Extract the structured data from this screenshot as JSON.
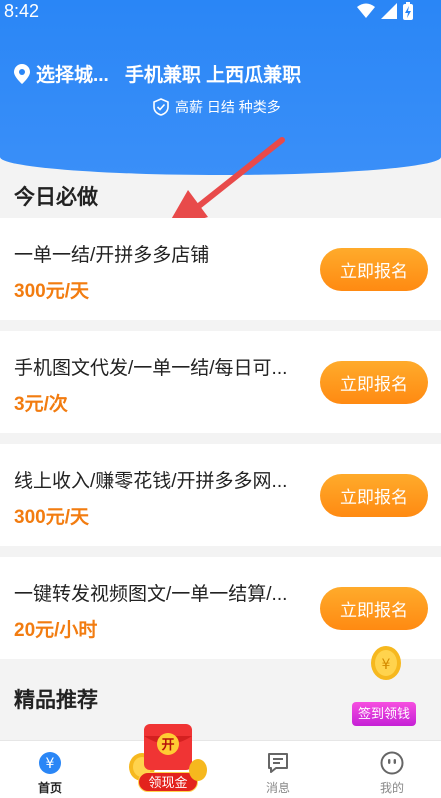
{
  "status": {
    "time": "8:42"
  },
  "header": {
    "city": "选择城...",
    "title": "手机兼职 上西瓜兼职",
    "tagline": "高薪 日结 种类多"
  },
  "sections": {
    "today": "今日必做",
    "featured": "精品推荐"
  },
  "jobs": [
    {
      "name": "一单一结/开拼多多店铺",
      "price": "300元/天",
      "button": "立即报名"
    },
    {
      "name": "手机图文代发/一单一结/每日可...",
      "price": "3元/次",
      "button": "立即报名"
    },
    {
      "name": "线上收入/赚零花钱/开拼多多网...",
      "price": "300元/天",
      "button": "立即报名"
    },
    {
      "name": "一键转发视频图文/一单一结算/...",
      "price": "20元/小时",
      "button": "立即报名"
    }
  ],
  "signin": {
    "label": "签到领钱"
  },
  "redpack": {
    "top": "开",
    "label": "领现金"
  },
  "tabs": [
    {
      "label": "首页",
      "icon": "home-yen-icon",
      "active": true
    },
    {
      "label": "消息",
      "icon": "message-icon",
      "active": false
    },
    {
      "label": "我的",
      "icon": "profile-icon",
      "active": false
    }
  ],
  "colors": {
    "brand_blue": "#2a86f6",
    "price_orange": "#f27c10",
    "button_orange": "#ff9a1e",
    "signin_pink": "#e03ad8"
  }
}
